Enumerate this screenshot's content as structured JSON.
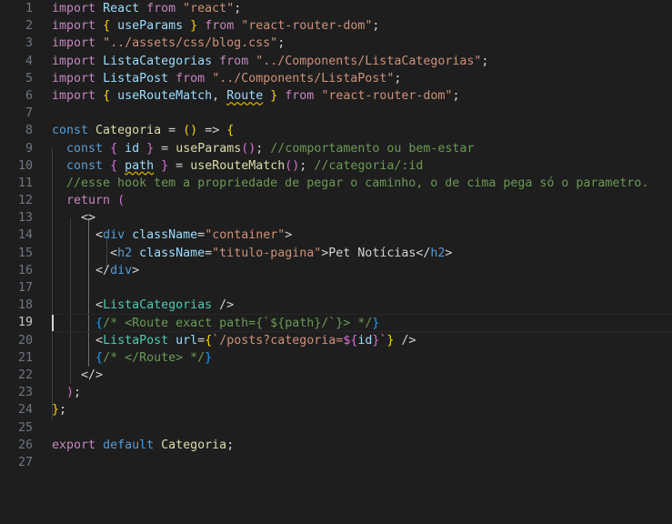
{
  "editor": {
    "language": "javascriptreact",
    "theme": "Dark+ (default dark)",
    "colors": {
      "background": "#1e1e1e",
      "foreground": "#d4d4d4",
      "line_number": "#6e7681",
      "line_number_active": "#c6c6c6",
      "keyword": "#c586c0",
      "keyword_storage": "#569cd6",
      "identifier": "#9cdcfe",
      "string": "#ce9178",
      "comment": "#6a9955",
      "function": "#dcdcaa",
      "component_tag": "#4ec9b0",
      "bracket_yellow": "#ffd700",
      "bracket_magenta": "#da70d6",
      "bracket_blue": "#179fff",
      "squiggle_warning": "#cca700",
      "indent_guide": "#404040",
      "indent_guide_active": "#707070",
      "cursor": "#d4d4d4"
    },
    "active_line": 19,
    "total_lines": 27,
    "cursor_line": 19,
    "cursor_column": 1,
    "warnings": [
      "Route",
      "path"
    ]
  },
  "lines": [
    {
      "n": "1",
      "text": "import React from \"react\";"
    },
    {
      "n": "2",
      "text": "import { useParams } from \"react-router-dom\";"
    },
    {
      "n": "3",
      "text": "import \"../assets/css/blog.css\";"
    },
    {
      "n": "4",
      "text": "import ListaCategorias from \"../Components/ListaCategorias\";"
    },
    {
      "n": "5",
      "text": "import ListaPost from \"../Components/ListaPost\";"
    },
    {
      "n": "6",
      "text": "import { useRouteMatch, Route } from \"react-router-dom\";"
    },
    {
      "n": "7",
      "text": ""
    },
    {
      "n": "8",
      "text": "const Categoria = () => {"
    },
    {
      "n": "9",
      "text": "  const { id } = useParams(); //comportamento ou bem-estar"
    },
    {
      "n": "10",
      "text": "  const { path } = useRouteMatch(); //categoria/:id"
    },
    {
      "n": "11",
      "text": "  //esse hook tem a propriedade de pegar o caminho, o de cima pega só o parametro."
    },
    {
      "n": "12",
      "text": "  return ("
    },
    {
      "n": "13",
      "text": "    <>"
    },
    {
      "n": "14",
      "text": "      <div className=\"container\">"
    },
    {
      "n": "15",
      "text": "        <h2 className=\"titulo-pagina\">Pet Notícias</h2>"
    },
    {
      "n": "16",
      "text": "      </div>"
    },
    {
      "n": "17",
      "text": ""
    },
    {
      "n": "18",
      "text": "      <ListaCategorias />"
    },
    {
      "n": "19",
      "text": "      {/* <Route exact path={`${path}/`}> */}"
    },
    {
      "n": "20",
      "text": "      <ListaPost url={`/posts?categoria=${id}`} />"
    },
    {
      "n": "21",
      "text": "      {/* </Route> */}"
    },
    {
      "n": "22",
      "text": "    </>"
    },
    {
      "n": "23",
      "text": "  );"
    },
    {
      "n": "24",
      "text": "};"
    },
    {
      "n": "25",
      "text": ""
    },
    {
      "n": "26",
      "text": "export default Categoria;"
    },
    {
      "n": "27",
      "text": ""
    }
  ]
}
